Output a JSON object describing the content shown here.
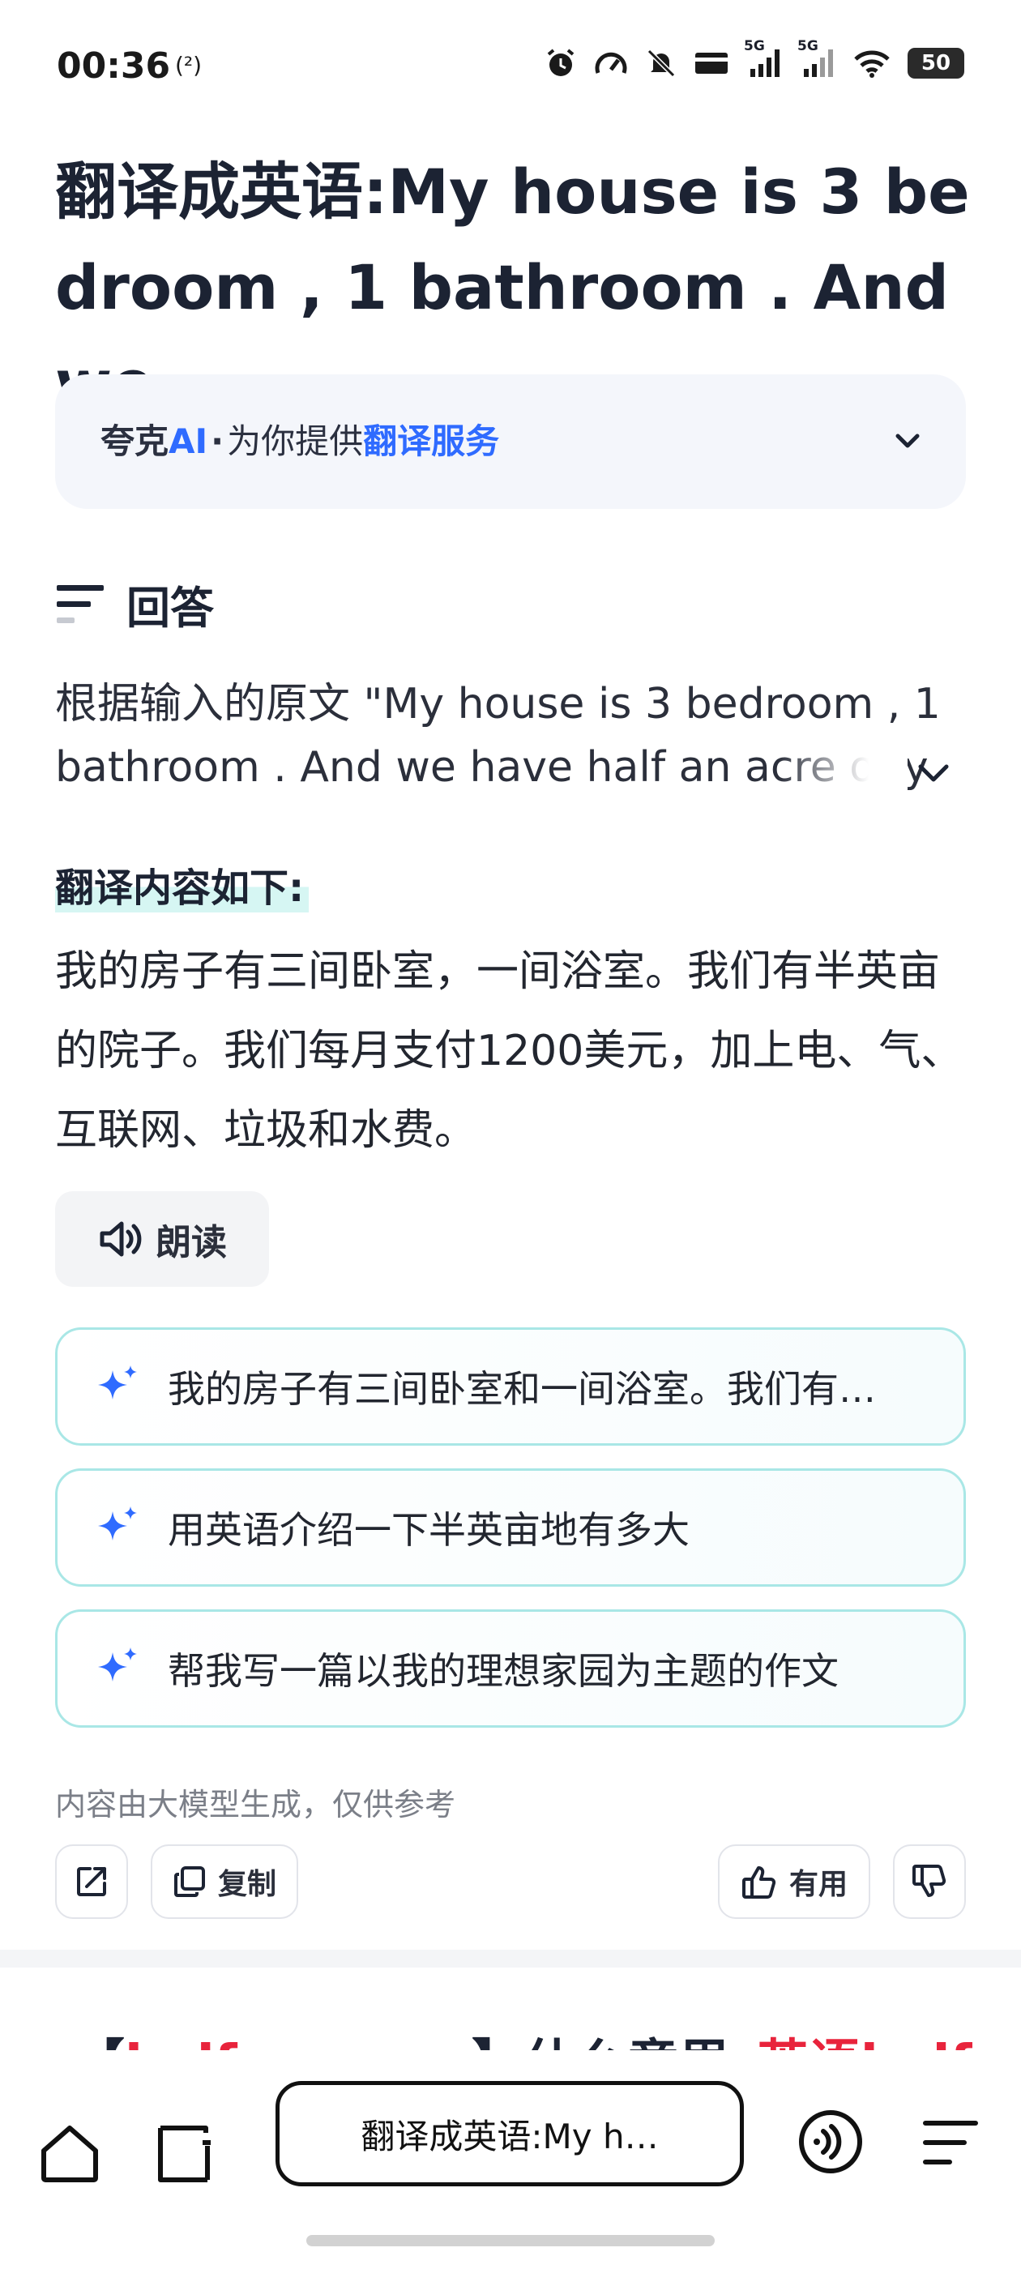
{
  "status": {
    "time": "00:36",
    "nfc": "(²)",
    "net1": "5G",
    "net2": "5G",
    "battery": "50"
  },
  "title": "翻译成英语:My house is 3 bedroom , 1 bathroom . And we …",
  "source": {
    "brand_prefix": "夸克",
    "brand_ai": "AI",
    "separator": "·",
    "provide_text": "为你提供",
    "service": "翻译服务"
  },
  "answer": {
    "heading": "回答",
    "original_preview": "根据输入的原文 \"My house is 3 bedroom , 1 bathroom . And we have half an acre of y",
    "translation_label": "翻译内容如下:",
    "translation_text": "我的房子有三间卧室，一间浴室。我们有半英亩的院子。我们每月支付1200美元，加上电、气、互联网、垃圾和水费。",
    "read_label": "朗读"
  },
  "suggestions": [
    {
      "text": "我的房子有三间卧室和一间浴室。我们有…"
    },
    {
      "text": "用英语介绍一下半英亩地有多大"
    },
    {
      "text": "帮我写一篇以我的理想家园为主题的作文"
    }
  ],
  "disclaimer": "内容由大模型生成，仅供参考",
  "actions": {
    "copy": "复制",
    "useful": "有用"
  },
  "next_result": {
    "bracket_open": "【",
    "term": "half an acre",
    "bracket_close": "】什么意思_",
    "tail": "英语half a"
  },
  "bottom_nav": {
    "search_text": "翻译成英语:My h…"
  },
  "colors": {
    "accent_blue": "#2f6bff",
    "teal_border": "#a9e7e6",
    "highlight": "#d6f6f3",
    "red": "#e8243c"
  }
}
